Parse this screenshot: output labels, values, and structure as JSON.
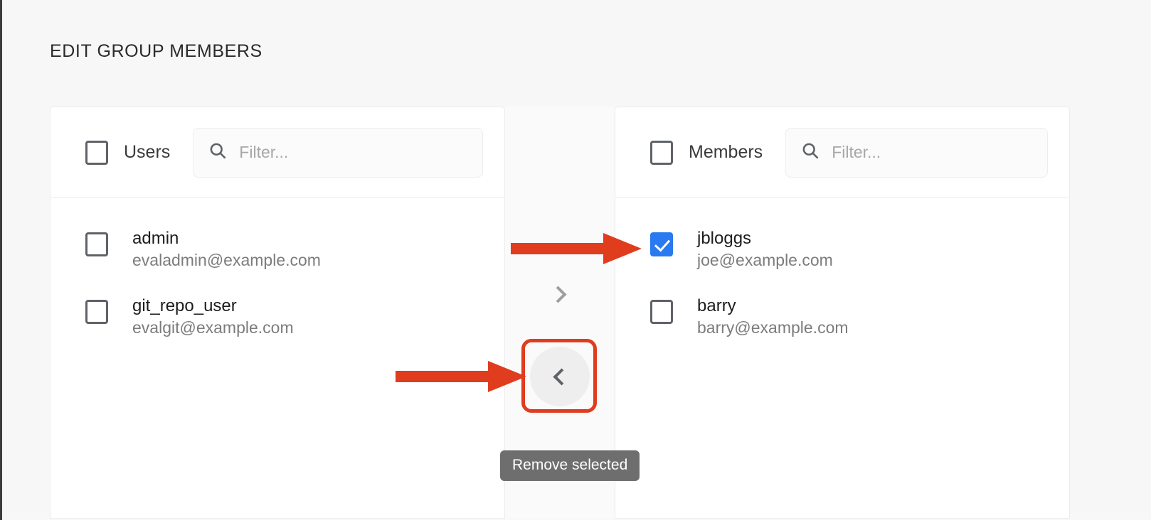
{
  "page": {
    "title": "EDIT GROUP MEMBERS"
  },
  "colors": {
    "annotation_red": "#e03c1e",
    "checkbox_checked_blue": "#2979f0",
    "tooltip_bg": "#6e6e6e",
    "panel_bg": "#ffffff",
    "page_bg": "#f7f7f7",
    "center_column_bg": "#fafafa",
    "checkbox_border": "#5f6368"
  },
  "left_panel": {
    "name": "users-panel",
    "header": {
      "select_all_label": "Users",
      "select_all_checked": false,
      "filter_placeholder": "Filter...",
      "filter_value": "",
      "search_icon": "search-icon"
    },
    "rows": [
      {
        "name": "admin",
        "email": "evaladmin@example.com",
        "checked": false
      },
      {
        "name": "git_repo_user",
        "email": "evalgit@example.com",
        "checked": false
      }
    ]
  },
  "center": {
    "forward_button": {
      "icon": "chevron-right-icon",
      "label": "",
      "enabled": false
    },
    "back_button": {
      "icon": "chevron-left-icon",
      "label": "",
      "enabled": true,
      "hovered": true
    },
    "tooltip": "Remove selected"
  },
  "right_panel": {
    "name": "members-panel",
    "header": {
      "select_all_label": "Members",
      "select_all_checked": false,
      "filter_placeholder": "Filter...",
      "filter_value": "",
      "search_icon": "search-icon"
    },
    "rows": [
      {
        "name": "jbloggs",
        "email": "joe@example.com",
        "checked": true
      },
      {
        "name": "barry",
        "email": "barry@example.com",
        "checked": false
      }
    ]
  },
  "annotations": [
    {
      "type": "arrow",
      "direction": "right",
      "target": "jbloggs-checkbox"
    },
    {
      "type": "arrow",
      "direction": "right",
      "target": "remove-selected-button"
    },
    {
      "type": "box",
      "target": "remove-selected-button"
    }
  ]
}
